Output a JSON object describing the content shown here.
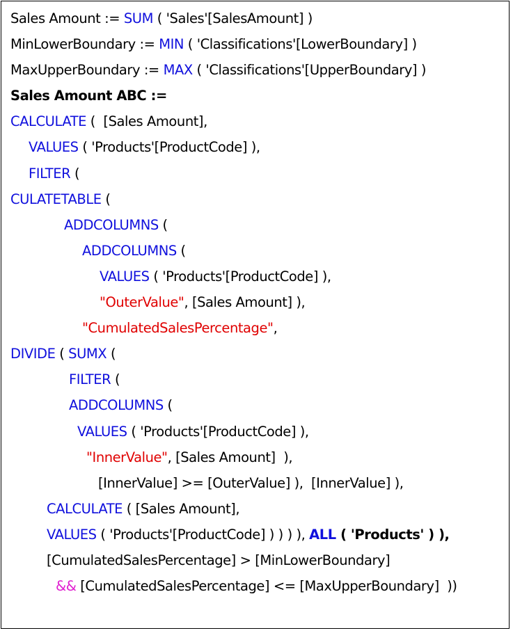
{
  "colors": {
    "keyword": "#1010dd",
    "string": "#e00000",
    "operator": "#e020d0",
    "text": "#000000"
  },
  "lines": [
    {
      "indent": 13,
      "segments": [
        {
          "t": "Sales Amount := "
        },
        {
          "t": "SUM",
          "c": "kw"
        },
        {
          "t": " ( 'Sales'[SalesAmount] )"
        }
      ]
    },
    {
      "indent": 13,
      "segments": [
        {
          "t": "MinLowerBoundary := "
        },
        {
          "t": "MIN",
          "c": "kw"
        },
        {
          "t": " ( 'Classifications'[LowerBoundary] )"
        }
      ]
    },
    {
      "indent": 13,
      "segments": [
        {
          "t": "MaxUpperBoundary := "
        },
        {
          "t": "MAX",
          "c": "kw"
        },
        {
          "t": " ( 'Classifications'[UpperBoundary] )"
        }
      ]
    },
    {
      "indent": 13,
      "segments": [
        {
          "t": "Sales Amount ABC :=",
          "c": "b"
        }
      ]
    },
    {
      "indent": 13,
      "segments": [
        {
          "t": "CALCULATE",
          "c": "kw"
        },
        {
          "t": " (  [Sales Amount],"
        }
      ]
    },
    {
      "indent": 39,
      "segments": [
        {
          "t": "VALUES",
          "c": "kw"
        },
        {
          "t": " ( 'Products'[ProductCode] ),"
        }
      ]
    },
    {
      "indent": 39,
      "segments": [
        {
          "t": "FILTER",
          "c": "kw"
        },
        {
          "t": " ("
        }
      ]
    },
    {
      "indent": 13,
      "segments": [
        {
          "t": "CULATETABLE",
          "c": "kw"
        },
        {
          "t": " ("
        }
      ]
    },
    {
      "indent": 90,
      "segments": [
        {
          "t": "ADDCOLUMNS",
          "c": "kw"
        },
        {
          "t": " ("
        }
      ]
    },
    {
      "indent": 116,
      "segments": [
        {
          "t": "ADDCOLUMNS",
          "c": "kw"
        },
        {
          "t": " ("
        }
      ]
    },
    {
      "indent": 141,
      "segments": [
        {
          "t": "VALUES",
          "c": "kw"
        },
        {
          "t": " ( 'Products'[ProductCode] ),"
        }
      ]
    },
    {
      "indent": 141,
      "segments": [
        {
          "t": "\"OuterValue\"",
          "c": "str"
        },
        {
          "t": ", [Sales Amount] ),"
        }
      ]
    },
    {
      "indent": 116,
      "segments": [
        {
          "t": "\"CumulatedSalesPercentage\"",
          "c": "str"
        },
        {
          "t": ","
        }
      ]
    },
    {
      "indent": 13,
      "segments": [
        {
          "t": "DIVIDE",
          "c": "kw"
        },
        {
          "t": " ( "
        },
        {
          "t": "SUMX",
          "c": "kw"
        },
        {
          "t": " ("
        }
      ]
    },
    {
      "indent": 97,
      "segments": [
        {
          "t": "FILTER",
          "c": "kw"
        },
        {
          "t": " ("
        }
      ]
    },
    {
      "indent": 97,
      "segments": [
        {
          "t": "ADDCOLUMNS",
          "c": "kw"
        },
        {
          "t": " ("
        }
      ]
    },
    {
      "indent": 109,
      "segments": [
        {
          "t": "VALUES",
          "c": "kw"
        },
        {
          "t": " ( 'Products'[ProductCode] ),"
        }
      ]
    },
    {
      "indent": 122,
      "segments": [
        {
          "t": "\"InnerValue\"",
          "c": "str"
        },
        {
          "t": ", [Sales Amount]  ),"
        }
      ]
    },
    {
      "indent": 139,
      "segments": [
        {
          "t": "[InnerValue] >= [OuterValue] ),  [InnerValue] ),"
        }
      ]
    },
    {
      "indent": 65,
      "segments": [
        {
          "t": "CALCULATE",
          "c": "kw"
        },
        {
          "t": " ( [Sales Amount],"
        }
      ]
    },
    {
      "indent": 65,
      "segments": [
        {
          "t": "VALUES",
          "c": "kw"
        },
        {
          "t": " ( 'Products'[ProductCode] ) ) ) ), "
        },
        {
          "t": "ALL",
          "c": "kw b"
        },
        {
          "t": " ( 'Products' ) ),",
          "c": "b"
        }
      ]
    },
    {
      "indent": 65,
      "segments": [
        {
          "t": "[CumulatedSalesPercentage] > [MinLowerBoundary]"
        }
      ]
    },
    {
      "indent": 78,
      "segments": [
        {
          "t": "&&",
          "c": "op"
        },
        {
          "t": " [CumulatedSalesPercentage] <= [MaxUpperBoundary]  ))"
        }
      ]
    }
  ]
}
